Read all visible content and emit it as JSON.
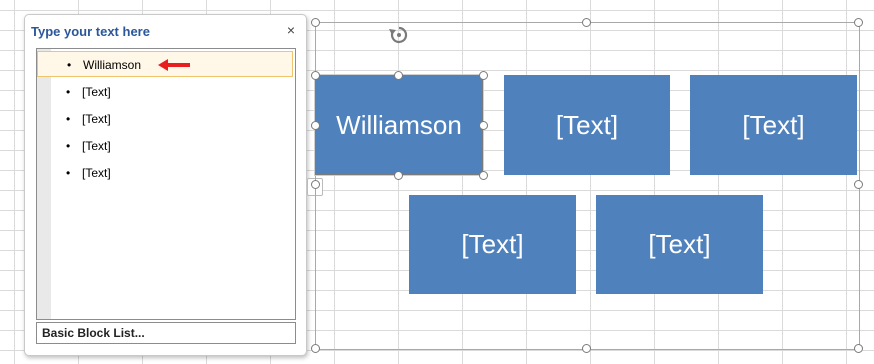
{
  "pane": {
    "title": "Type your text here",
    "close_glyph": "×",
    "items": [
      {
        "label": "Williamson",
        "selected": true
      },
      {
        "label": "[Text]"
      },
      {
        "label": "[Text]"
      },
      {
        "label": "[Text]"
      },
      {
        "label": "[Text]"
      }
    ],
    "footer": "Basic Block List..."
  },
  "blocks": [
    "Williamson",
    "[Text]",
    "[Text]",
    "[Text]",
    "[Text]"
  ],
  "colors": {
    "block_fill": "#4f81bd",
    "pane_title": "#2b579a",
    "arrow": "#e81f1f"
  },
  "icons": {
    "rotate": "rotate-handle-icon",
    "close": "close-icon",
    "expand": "chevron-right-icon",
    "arrow": "red-arrow-icon"
  }
}
